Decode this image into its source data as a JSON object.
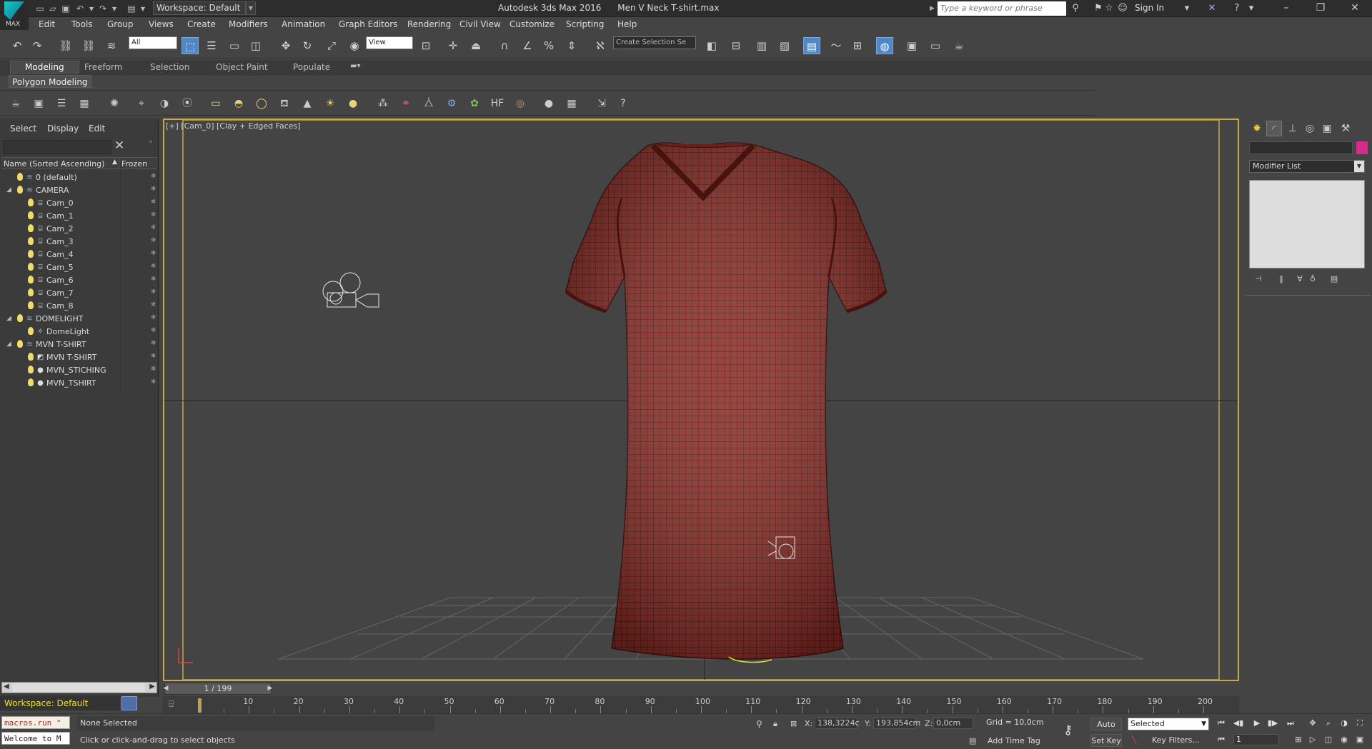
{
  "titlebar": {
    "workspace": "Workspace: Default",
    "app_title": "Autodesk 3ds Max 2016      Men V Neck T-shirt.max",
    "search_placeholder": "Type a keyword or phrase",
    "sign_in": "Sign In",
    "logo_label": "MAX"
  },
  "menus": [
    "Edit",
    "Tools",
    "Group",
    "Views",
    "Create",
    "Modifiers",
    "Animation",
    "Graph Editors",
    "Rendering",
    "Civil View",
    "Customize",
    "Scripting",
    "Help"
  ],
  "main_toolbar": {
    "selection_filter": "All",
    "ref_coord": "View",
    "named_selection": "Create Selection Se"
  },
  "ribbon": {
    "tabs": [
      "Modeling",
      "Freeform",
      "Selection",
      "Object Paint",
      "Populate"
    ],
    "active_tab": "Modeling",
    "panel": "Polygon Modeling"
  },
  "scene_explorer": {
    "menu": [
      "Select",
      "Display",
      "Edit"
    ],
    "col_name": "Name (Sorted Ascending)",
    "col_frozen": "Frozen",
    "rows": [
      {
        "name": "0 (default)",
        "level": 0,
        "type": "layer",
        "expandable": false
      },
      {
        "name": "CAMERA",
        "level": 0,
        "type": "layer",
        "expandable": true
      },
      {
        "name": "Cam_0",
        "level": 1,
        "type": "camera"
      },
      {
        "name": "Cam_1",
        "level": 1,
        "type": "camera"
      },
      {
        "name": "Cam_2",
        "level": 1,
        "type": "camera"
      },
      {
        "name": "Cam_3",
        "level": 1,
        "type": "camera"
      },
      {
        "name": "Cam_4",
        "level": 1,
        "type": "camera"
      },
      {
        "name": "Cam_5",
        "level": 1,
        "type": "camera"
      },
      {
        "name": "Cam_6",
        "level": 1,
        "type": "camera"
      },
      {
        "name": "Cam_7",
        "level": 1,
        "type": "camera"
      },
      {
        "name": "Cam_8",
        "level": 1,
        "type": "camera"
      },
      {
        "name": "DOMELIGHT",
        "level": 0,
        "type": "layer",
        "expandable": true
      },
      {
        "name": "DomeLight",
        "level": 1,
        "type": "light"
      },
      {
        "name": "MVN T-SHIRT",
        "level": 0,
        "type": "layer",
        "expandable": true
      },
      {
        "name": "MVN T-SHIRT",
        "level": 1,
        "type": "mesh"
      },
      {
        "name": "MVN_STICHING",
        "level": 1,
        "type": "sphere"
      },
      {
        "name": "MVN_TSHIRT",
        "level": 1,
        "type": "sphere"
      }
    ],
    "workspace": "Workspace: Default"
  },
  "viewport": {
    "label": "[+] [Cam_0] [Clay + Edged Faces]",
    "shirt_color": "#8a2b24",
    "frame_color": "#c7a94a"
  },
  "command_panel": {
    "modifier_list": "Modifier List",
    "object_color": "#d62a8c"
  },
  "timeline": {
    "position": "1 / 199",
    "current_frame": 1,
    "total_frames": 199,
    "ticks": [
      10,
      20,
      30,
      40,
      50,
      60,
      70,
      80,
      90,
      100,
      110,
      120,
      130,
      140,
      150,
      160,
      170,
      180,
      190,
      200
    ]
  },
  "status": {
    "maxscript_line1": "macros.run \"",
    "maxscript_line2": "Welcome to M",
    "selection": "None Selected",
    "prompt": "Click or click-and-drag to select objects",
    "x_label": "X:",
    "x_value": "138,3224c",
    "y_label": "Y:",
    "y_value": "193,854cm",
    "z_label": "Z:",
    "z_value": "0,0cm",
    "grid": "Grid = 10,0cm",
    "add_time_tag": "Add Time Tag",
    "auto_key": "Auto Key",
    "set_key": "Set Key",
    "key_mode": "Selected",
    "key_filters": "Key Filters...",
    "frame": "1"
  }
}
